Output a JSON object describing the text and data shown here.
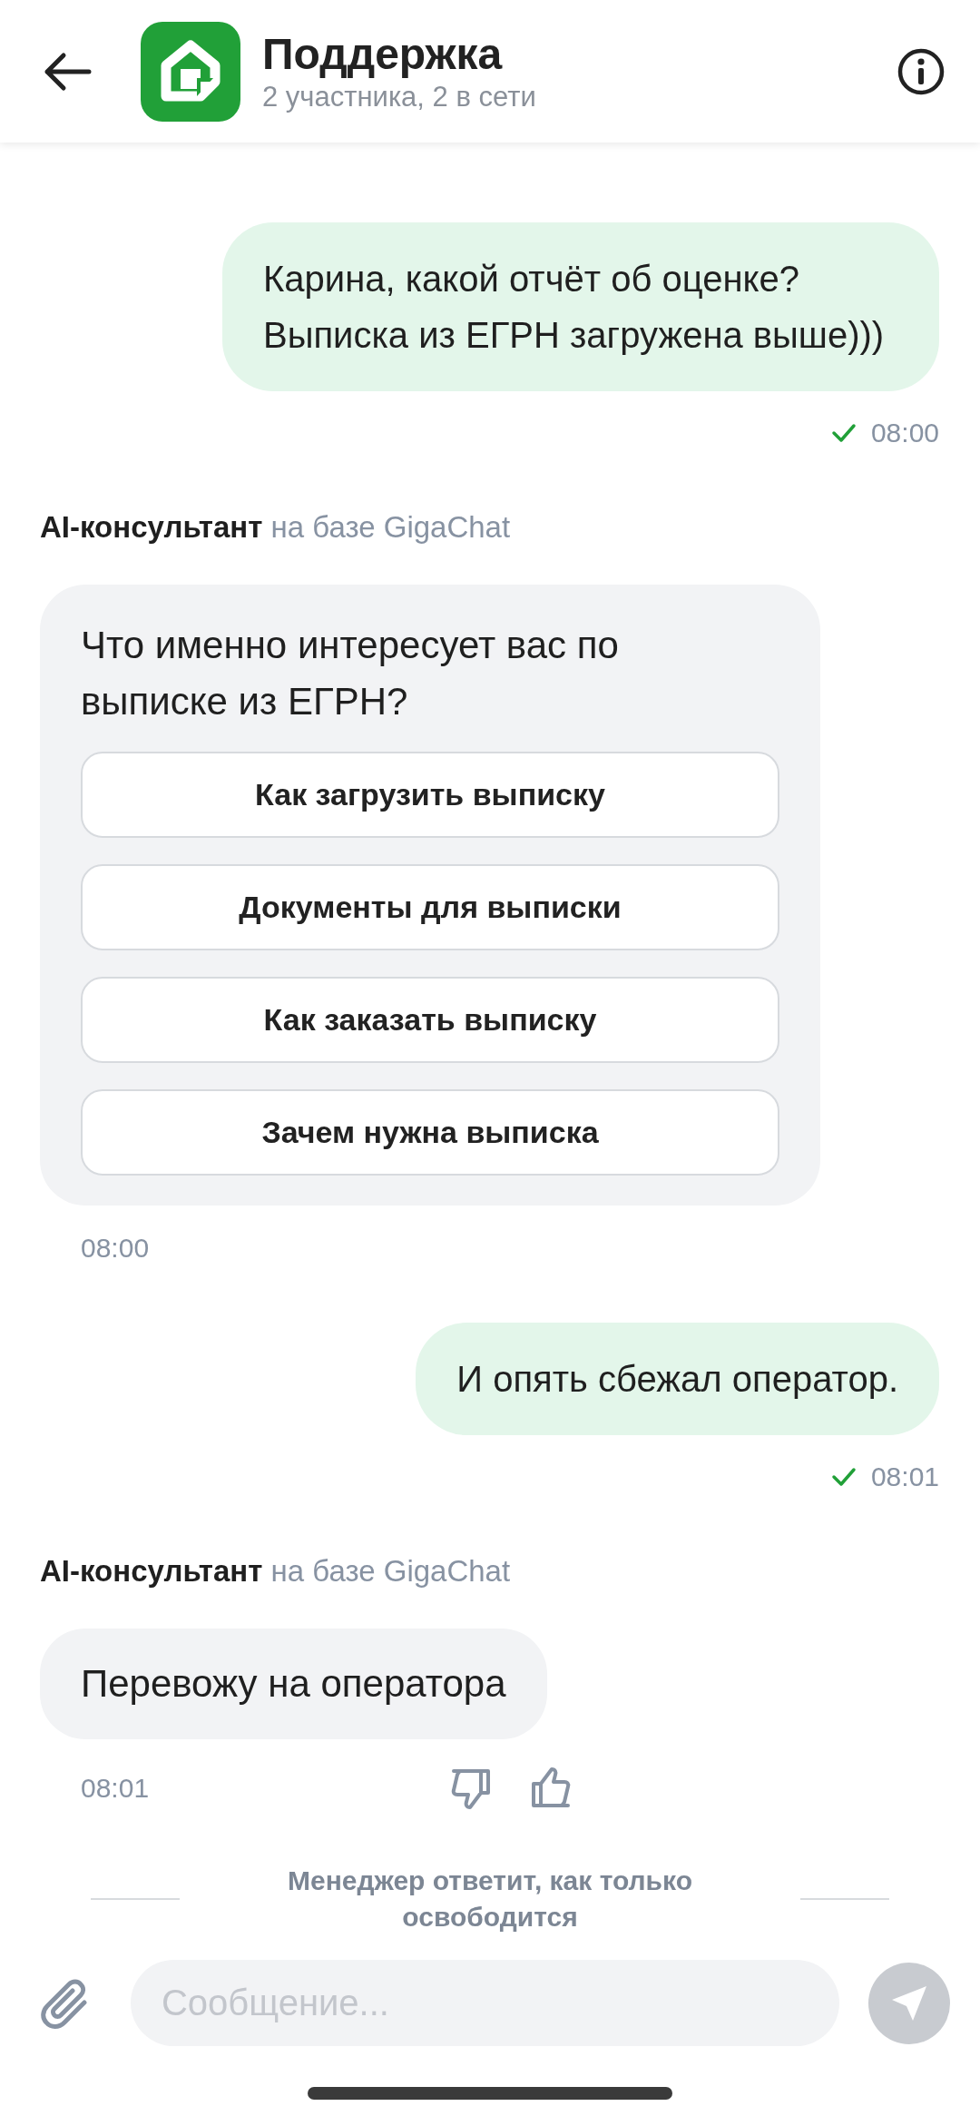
{
  "header": {
    "title": "Поддержка",
    "subtitle": "2 участника, 2 в сети"
  },
  "messages": [
    {
      "kind": "outgoing",
      "text": "Карина, какой отчёт об оценке? Выписка из ЕГРН загружена выше)))",
      "time": "08:00",
      "delivered": true
    },
    {
      "kind": "bot",
      "sender": "AI-консультант",
      "sender_note": "на базе GigaChat",
      "text": "Что именно интересует вас по выписке из ЕГРН?",
      "quick_replies": [
        "Как загрузить выписку",
        "Документы для выписки",
        "Как заказать выписку",
        "Зачем нужна выписка"
      ],
      "time": "08:00",
      "feedback": false
    },
    {
      "kind": "outgoing",
      "text": "И опять сбежал оператор.",
      "time": "08:01",
      "delivered": true
    },
    {
      "kind": "bot",
      "sender": "AI-консультант",
      "sender_note": "на базе GigaChat",
      "text": "Перевожу на оператора",
      "time": "08:01",
      "feedback": true
    }
  ],
  "notice": "Менеджер ответит, как только освободится",
  "composer": {
    "placeholder": "Сообщение..."
  }
}
